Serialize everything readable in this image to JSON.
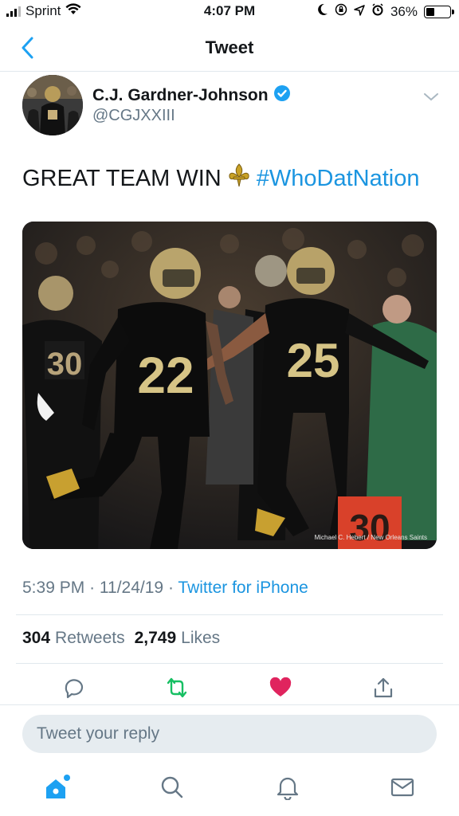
{
  "status_bar": {
    "carrier": "Sprint",
    "time": "4:07 PM",
    "battery": "36%",
    "battery_level": 0.36,
    "icons": [
      "signal-icon",
      "wifi-icon",
      "moon-icon",
      "rotation-lock-icon",
      "location-icon",
      "alarm-icon",
      "battery-icon"
    ]
  },
  "nav": {
    "title": "Tweet",
    "back_icon": "back-chevron-icon"
  },
  "author": {
    "name": "C.J. Gardner-Johnson",
    "handle": "@CGJXXIII",
    "verified": true,
    "menu_icon": "chevron-down-icon"
  },
  "tweet": {
    "text_before": "GREAT TEAM WIN",
    "emoji_icon": "fleur-de-lis-icon",
    "hashtag": "#WhoDatNation",
    "media": {
      "credit": "Michael C. Hebert / New Orleans Saints",
      "jersey_numbers": [
        "22",
        "25",
        "30"
      ],
      "yard_marker": "30"
    }
  },
  "meta": {
    "time": "5:39 PM",
    "sep1": "·",
    "date": "11/24/19",
    "sep2": "·",
    "source": "Twitter for iPhone"
  },
  "stats": {
    "retweets_count": "304",
    "retweets_label": "Retweets",
    "likes_count": "2,749",
    "likes_label": "Likes"
  },
  "actions": {
    "items": [
      "reply-icon",
      "retweet-icon",
      "like-icon",
      "share-icon"
    ],
    "retweet_color": "#17bf63",
    "like_color": "#e0245e"
  },
  "reply": {
    "placeholder": "Tweet your reply"
  },
  "tab_bar": {
    "items": [
      "home-icon",
      "search-icon",
      "notifications-icon",
      "messages-icon"
    ],
    "active": "home-icon"
  },
  "colors": {
    "accent": "#1da1f2",
    "link": "#1b95e0",
    "text_secondary": "#657786",
    "border": "#e1e8ed",
    "reply_bg": "#e6ecf0"
  }
}
